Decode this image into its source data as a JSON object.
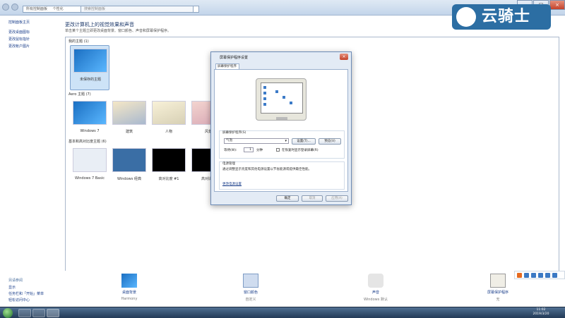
{
  "window": {
    "address_parts": [
      "所有控制面板",
      "个性化"
    ],
    "search_placeholder": "搜索控制面板"
  },
  "watermark": {
    "text": "云骑士"
  },
  "sidebar": {
    "items": [
      {
        "label": "控制面板主页"
      },
      {
        "label": "更改桌面图标"
      },
      {
        "label": "更改鼠标指针"
      },
      {
        "label": "更改帐户图片"
      }
    ],
    "see_also_title": "另请参阅",
    "see_also": [
      {
        "label": "显示"
      },
      {
        "label": "任务栏和「开始」菜单"
      },
      {
        "label": "轻松访问中心"
      }
    ]
  },
  "main": {
    "title": "更改计算机上的视觉效果和声音",
    "description": "单击某个主题立即更改桌面背景、窗口颜色、声音和屏幕保护程序。",
    "my_themes_label": "我的主题 (1)",
    "my_themes": [
      {
        "name": "未保存的主题",
        "style": "w7",
        "selected": true
      }
    ],
    "aero_label": "Aero 主题 (7)",
    "aero_themes": [
      {
        "name": "Windows 7",
        "style": "w7"
      },
      {
        "name": "建筑",
        "style": "arch"
      },
      {
        "name": "人物",
        "style": "char"
      },
      {
        "name": "风景",
        "style": "land"
      }
    ],
    "basic_label": "基本和高对比度主题 (6)",
    "basic_themes": [
      {
        "name": "Windows 7 Basic",
        "style": "basic"
      },
      {
        "name": "Windows 经典",
        "style": "classic"
      },
      {
        "name": "高对比度 #1",
        "style": "hc"
      },
      {
        "name": "高对比度",
        "style": "hc"
      }
    ]
  },
  "bottom": {
    "desktop_bg": {
      "title": "桌面背景",
      "sub": "Harmony"
    },
    "window_color": {
      "title": "窗口颜色",
      "sub": "自定义"
    },
    "sounds": {
      "title": "声音",
      "sub": "Windows 默认"
    },
    "screensaver": {
      "title": "屏幕保护程序",
      "sub": "无"
    }
  },
  "dialog": {
    "title": "屏幕保护程序设置",
    "tab": "屏幕保护程序",
    "screensaver_group": "屏幕保护程序(S)",
    "selected_saver": "气泡",
    "settings_button": "设置(T)...",
    "preview_button": "预览(V)",
    "wait_label": "等待(W):",
    "wait_value": "1",
    "wait_unit": "分钟",
    "resume_label": "在恢复时显示登录屏幕(R)",
    "power_group": "电源管理",
    "power_desc": "通过调整显示亮度和其他电源设置以节省能源或提供最佳性能。",
    "power_link": "更改电源设置",
    "ok": "确定",
    "cancel": "取消",
    "apply": "应用(A)"
  },
  "taskbar": {
    "clock_time": "11:02",
    "clock_date": "2019/3/20"
  }
}
